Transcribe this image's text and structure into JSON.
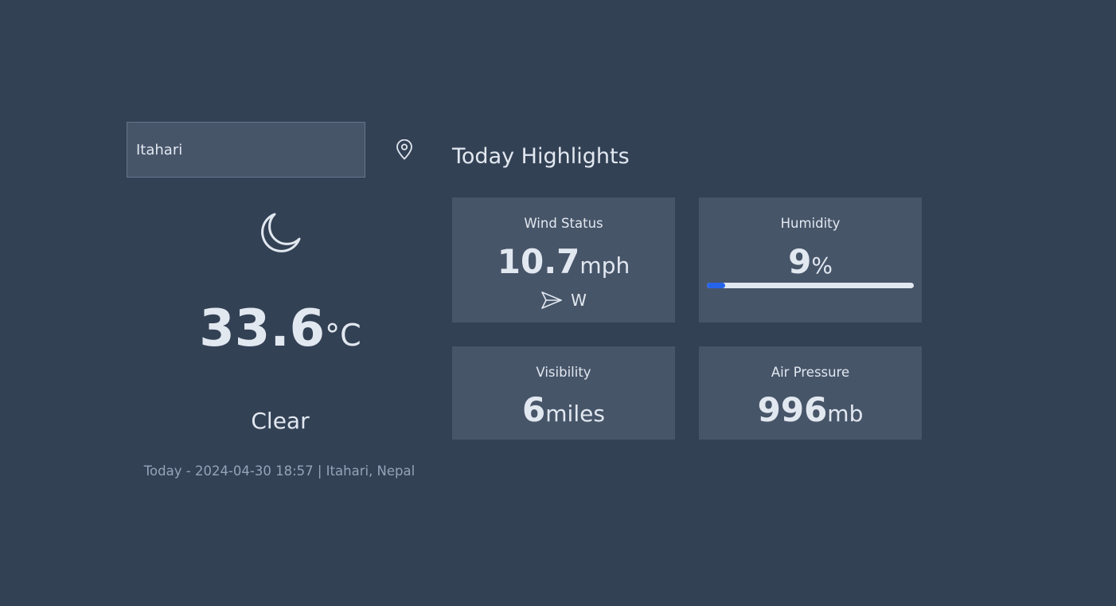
{
  "search": {
    "value": "Itahari"
  },
  "location_button": {
    "icon": "map-pin-icon"
  },
  "current": {
    "icon": "moon-icon",
    "temperature": "33.6",
    "temperature_unit": "°C",
    "condition": "Clear",
    "datetime": "Today - 2024-04-30 18:57 | Itahari, Nepal"
  },
  "highlights": {
    "title": "Today Highlights",
    "wind": {
      "title": "Wind Status",
      "value": "10.7",
      "unit": "mph",
      "direction": "W",
      "direction_icon": "navigation-arrow-icon"
    },
    "humidity": {
      "title": "Humidity",
      "value": "9",
      "unit": "%",
      "percent": 9
    },
    "visibility": {
      "title": "Visibility",
      "value": "6",
      "unit": "miles"
    },
    "pressure": {
      "title": "Air Pressure",
      "value": "996",
      "unit": "mb"
    }
  },
  "colors": {
    "background": "#334155",
    "card": "#475569",
    "text": "#e2e8f0",
    "muted_text": "#94a3b8",
    "accent": "#2563eb"
  }
}
